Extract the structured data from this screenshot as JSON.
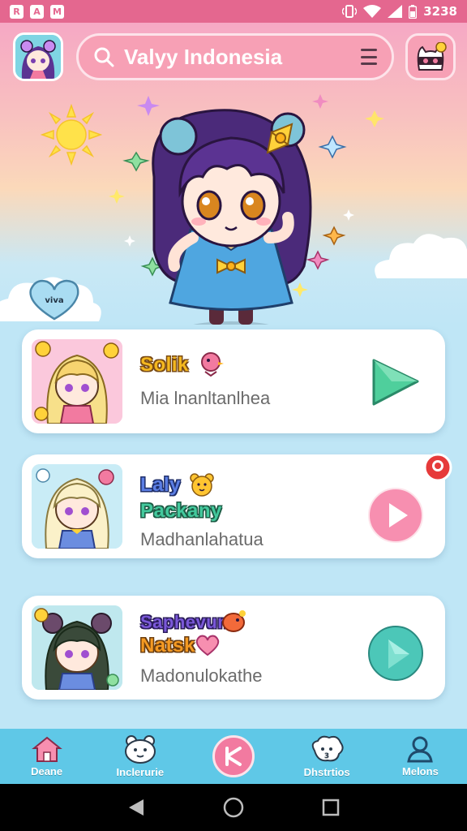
{
  "status_bar": {
    "left_icons": [
      "R",
      "A",
      "M"
    ],
    "time": "3238"
  },
  "header": {
    "search": {
      "value": "Valyy Indonesia",
      "placeholder": ""
    }
  },
  "hero": {
    "bubble_text": "viva"
  },
  "list": [
    {
      "title_line1": "Solik",
      "title_line2": "",
      "subtitle": "Mia lnanltanlhea",
      "play_color": "#4fcf9c",
      "title_color": "yellow"
    },
    {
      "title_line1": "Laly",
      "title_line2": "Packany",
      "subtitle": "Madhanlahatua",
      "play_color": "#f78fb0",
      "title_color": "blue"
    },
    {
      "title_line1": "Saphevun",
      "title_line2": "Natsk",
      "subtitle": "Madonulokathe",
      "play_color": "#4cc7b8",
      "title_color": "purple"
    }
  ],
  "bottom_nav": [
    {
      "label": "Deane",
      "icon": "home-icon"
    },
    {
      "label": "Inclerurie",
      "icon": "bear-icon"
    },
    {
      "label": "",
      "icon": "center-action-icon"
    },
    {
      "label": "Dhstrtios",
      "icon": "sheep-icon"
    },
    {
      "label": "Melons",
      "icon": "profile-icon"
    }
  ],
  "colors": {
    "status_bar": "#e4678f",
    "search_bar": "#f7a0b5",
    "bottom_nav": "#5fc8e7",
    "accent_pink": "#f27aa0"
  }
}
